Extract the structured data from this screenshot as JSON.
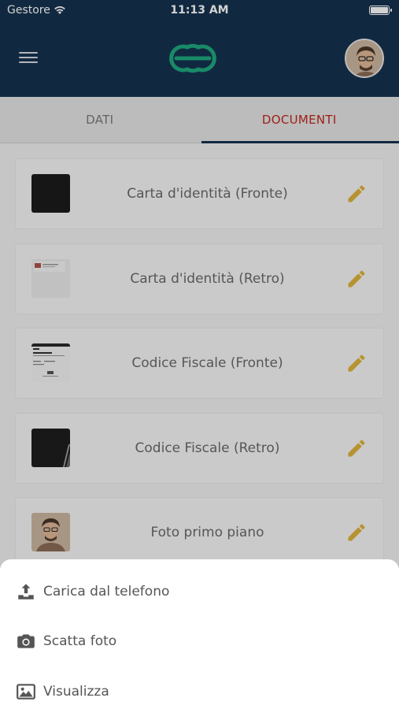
{
  "status_bar": {
    "carrier": "Gestore",
    "time": "11:13 AM"
  },
  "header": {
    "menu_icon": "hamburger-menu-icon",
    "logo": "app-logo",
    "avatar": "user-avatar"
  },
  "tabs": [
    {
      "label": "DATI",
      "active": false
    },
    {
      "label": "DOCUMENTI",
      "active": true
    }
  ],
  "documents": [
    {
      "label": "Carta d'identità (Fronte)",
      "thumb": "dark"
    },
    {
      "label": "Carta d'identità (Retro)",
      "thumb": "light-doc"
    },
    {
      "label": "Codice Fiscale (Fronte)",
      "thumb": "text-doc"
    },
    {
      "label": "Codice Fiscale (Retro)",
      "thumb": "dark"
    },
    {
      "label": "Foto primo piano",
      "thumb": "portrait"
    }
  ],
  "sheet": [
    {
      "label": "Carica dal telefono",
      "icon": "upload-icon"
    },
    {
      "label": "Scatta foto",
      "icon": "camera-icon"
    },
    {
      "label": "Visualizza",
      "icon": "image-icon"
    }
  ],
  "colors": {
    "header_bg": "#15324f",
    "active_tab": "#c0281e",
    "edit_icon": "#e0b43a",
    "logo": "#1fa97e"
  }
}
